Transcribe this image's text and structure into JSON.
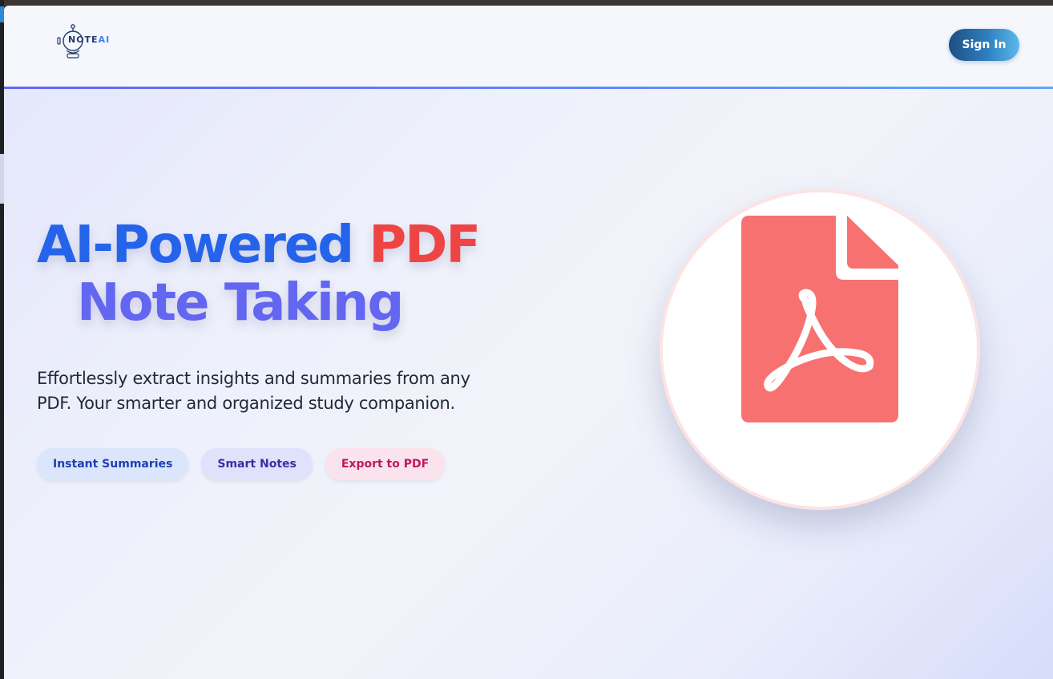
{
  "brand": {
    "logo_text": "NOTE",
    "logo_text_accent": "AI"
  },
  "header": {
    "signin_label": "Sign In"
  },
  "hero": {
    "title_part1": "AI-Powered",
    "title_part2": "PDF",
    "title_line2": "Note Taking",
    "subtitle": "Effortlessly extract insights and summaries from any PDF. Your smarter and organized study companion."
  },
  "features": [
    {
      "label": "Instant Summaries"
    },
    {
      "label": "Smart Notes"
    },
    {
      "label": "Export to PDF"
    }
  ],
  "icons": {
    "hero_icon": "pdf-file-icon",
    "logo_icon": "robot-icon"
  },
  "colors": {
    "primary_blue": "#2563eb",
    "accent_red": "#ef4444",
    "indigo": "#6366f1",
    "pdf_icon": "#f87171"
  }
}
